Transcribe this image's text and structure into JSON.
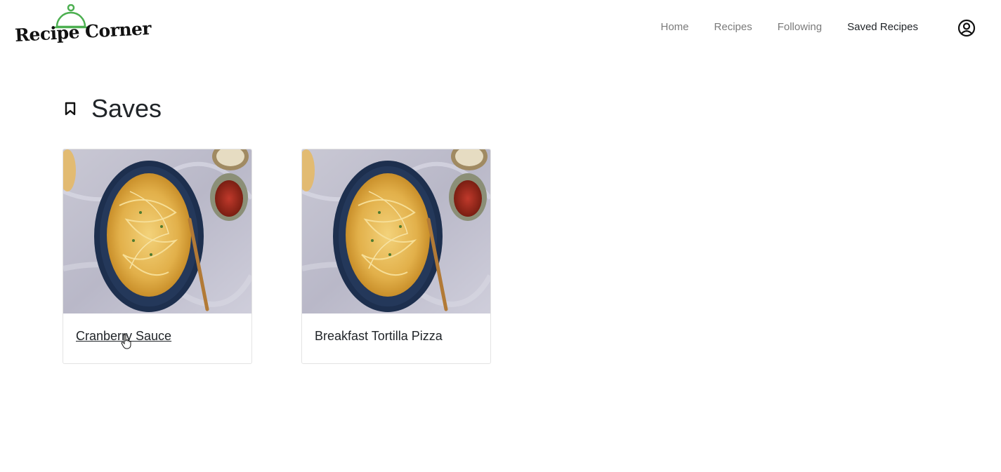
{
  "brand": {
    "name": "Recipe Corner",
    "icon": "cloche-icon",
    "accent_color": "#4caf50"
  },
  "nav": {
    "items": [
      {
        "label": "Home",
        "active": false
      },
      {
        "label": "Recipes",
        "active": false
      },
      {
        "label": "Following",
        "active": false
      },
      {
        "label": "Saved Recipes",
        "active": true
      }
    ],
    "profile_icon": "user-circle-icon"
  },
  "page": {
    "title": "Saves",
    "title_icon": "bookmark-icon"
  },
  "saved_recipes": [
    {
      "title": "Cranberry Sauce",
      "image": "spaghetti-dish-photo"
    },
    {
      "title": "Breakfast Tortilla Pizza",
      "image": "spaghetti-dish-photo"
    }
  ]
}
